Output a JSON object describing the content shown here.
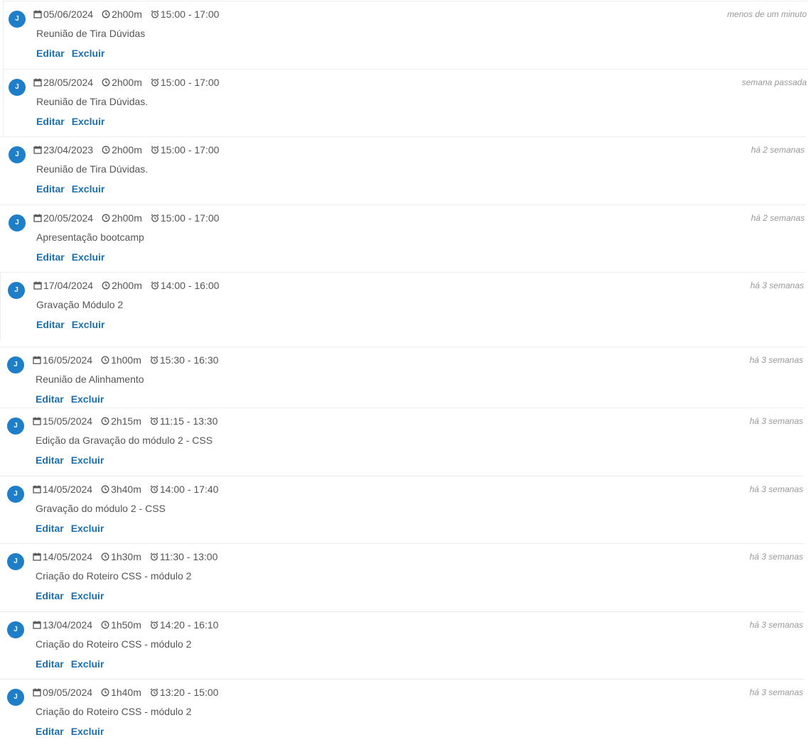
{
  "actions": {
    "edit_label": "Editar",
    "delete_label": "Excluir"
  },
  "colors": {
    "avatar": "#1f7ec8",
    "link": "#1a6fb0",
    "muted": "#999999",
    "text": "#555555"
  },
  "icons": {
    "date": "calendar-icon",
    "duration": "clock-icon",
    "time_range": "alarm-clock-icon"
  },
  "entries": [
    {
      "avatar": "J",
      "date": "05/06/2024",
      "duration": "2h00m",
      "time": "15:00 - 17:00",
      "description": "Reunião de Tira Dúvidas",
      "ago": "menos de um minuto"
    },
    {
      "avatar": "J",
      "date": "28/05/2024",
      "duration": "2h00m",
      "time": "15:00 - 17:00",
      "description": "Reunião de Tira Dúvidas.",
      "ago": "semana passada"
    },
    {
      "avatar": "J",
      "date": "23/04/2023",
      "duration": "2h00m",
      "time": "15:00 - 17:00",
      "description": "Reunião de Tira Dúvidas.",
      "ago": "há 2 semanas"
    },
    {
      "avatar": "J",
      "date": "20/05/2024",
      "duration": "2h00m",
      "time": "15:00 - 17:00",
      "description": "Apresentação bootcamp",
      "ago": "há 2 semanas"
    },
    {
      "avatar": "J",
      "date": "17/04/2024",
      "duration": "2h00m",
      "time": "14:00 - 16:00",
      "description": "Gravação Módulo 2",
      "ago": "há 3 semanas"
    },
    {
      "avatar": "J",
      "date": "16/05/2024",
      "duration": "1h00m",
      "time": "15:30 - 16:30",
      "description": "Reunião de Alinhamento",
      "ago": "há 3 semanas"
    },
    {
      "avatar": "J",
      "date": "15/05/2024",
      "duration": "2h15m",
      "time": "11:15 - 13:30",
      "description": "Edição da Gravação do módulo 2 - CSS",
      "ago": "há 3 semanas"
    },
    {
      "avatar": "J",
      "date": "14/05/2024",
      "duration": "3h40m",
      "time": "14:00 - 17:40",
      "description": "Gravação do módulo 2 - CSS",
      "ago": "há 3 semanas"
    },
    {
      "avatar": "J",
      "date": "14/05/2024",
      "duration": "1h30m",
      "time": "11:30 - 13:00",
      "description": "Criação do Roteiro CSS - módulo 2",
      "ago": "há 3 semanas"
    },
    {
      "avatar": "J",
      "date": "13/04/2024",
      "duration": "1h50m",
      "time": "14:20 - 16:10",
      "description": "Criação do Roteiro CSS - módulo 2",
      "ago": "há 3 semanas"
    },
    {
      "avatar": "J",
      "date": "09/05/2024",
      "duration": "1h40m",
      "time": "13:20 - 15:00",
      "description": "Criação do Roteiro CSS - módulo 2",
      "ago": "há 3 semanas"
    }
  ]
}
